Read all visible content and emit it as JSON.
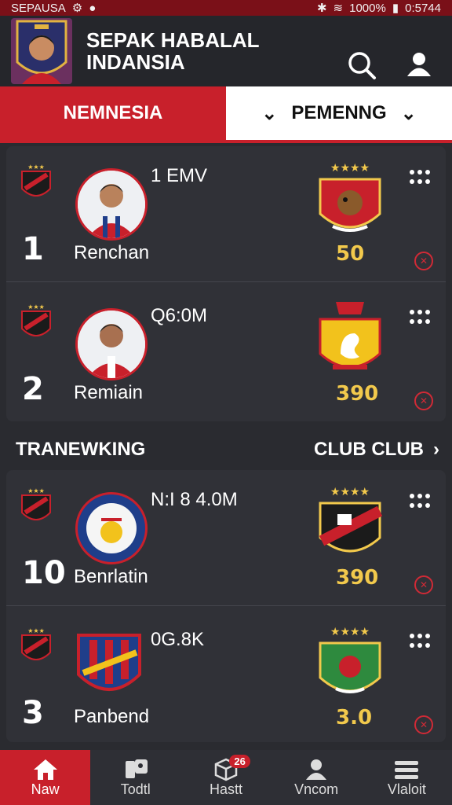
{
  "status_bar": {
    "carrier": "SEPAUSA",
    "battery": "1000%",
    "time": "0:5744"
  },
  "header": {
    "title_line1": "SEPAK HABALAL",
    "title_line2": "INDANSIA"
  },
  "tabs": {
    "tab1": "NEMNESIA",
    "tab2": "PEMENNG"
  },
  "players_top": [
    {
      "rank": "1",
      "value": "1 EMV",
      "name": "Renchan",
      "score": "50"
    },
    {
      "rank": "2",
      "value": "Q6:0M",
      "name": "Remiain",
      "score": "390"
    }
  ],
  "section": {
    "title": "TRANEWKING",
    "link": "CLUB CLUB"
  },
  "players_bottom": [
    {
      "rank": "10",
      "value": "N:I 8 4.0M",
      "name": "Benrlatin",
      "score": "390"
    },
    {
      "rank": "3",
      "value": "0G.8K",
      "name": "Panbend",
      "score": "3.0"
    }
  ],
  "nav": {
    "items": [
      {
        "label": "Naw"
      },
      {
        "label": "Todtl"
      },
      {
        "label": "Hastt",
        "badge": "26"
      },
      {
        "label": "Vncom"
      },
      {
        "label": "Vlaloit"
      }
    ]
  },
  "colors": {
    "accent": "#c8202b",
    "score": "#f2c94c",
    "background": "#2a2b30"
  }
}
